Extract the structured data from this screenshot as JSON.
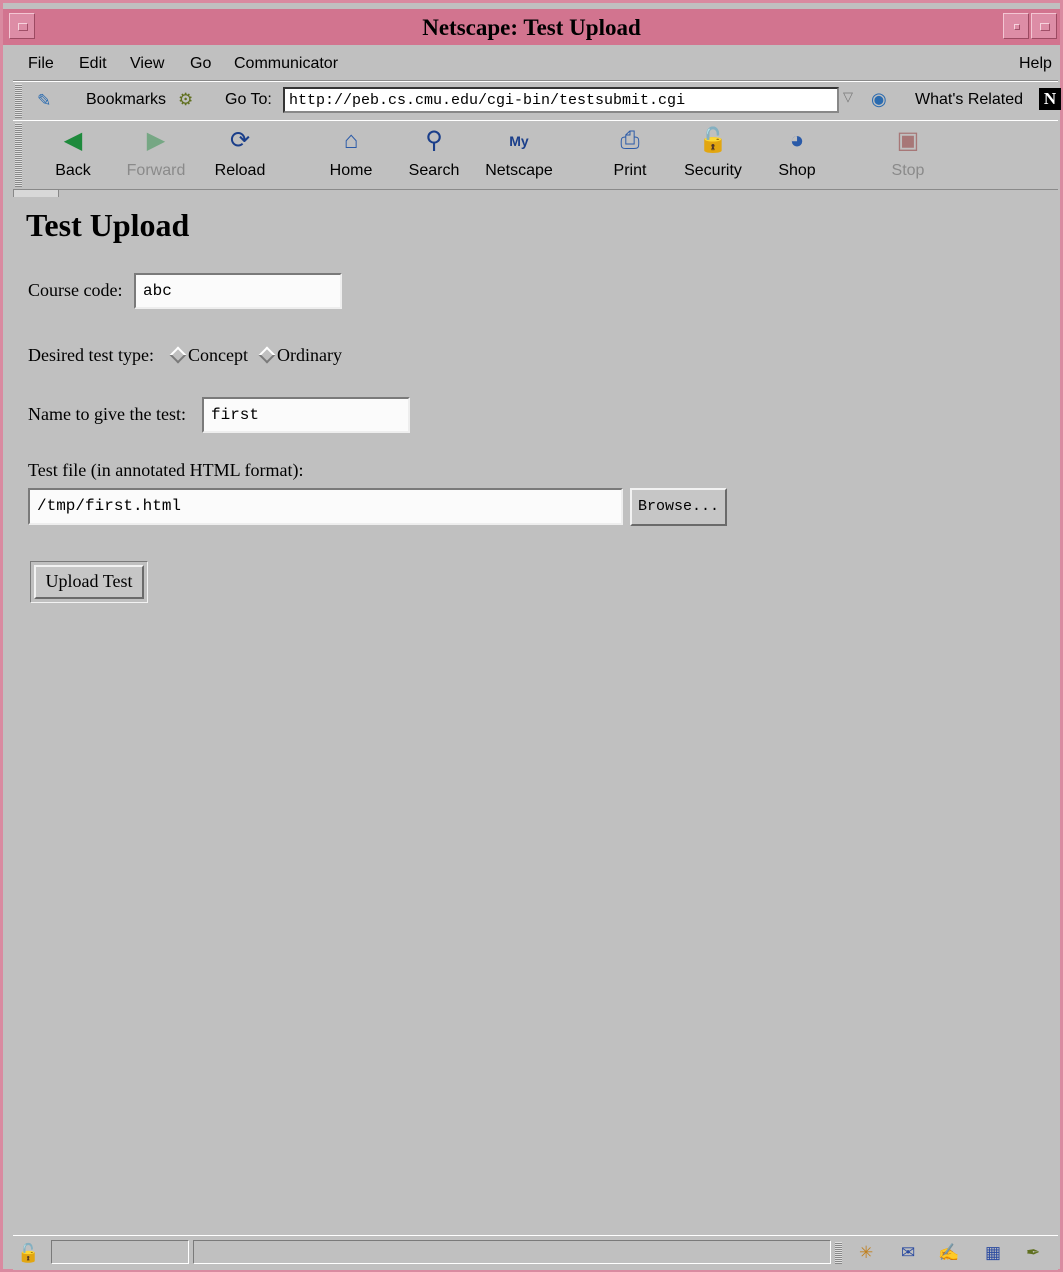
{
  "window": {
    "title": "Netscape: Test Upload"
  },
  "menubar": {
    "items": [
      "File",
      "Edit",
      "View",
      "Go",
      "Communicator"
    ],
    "help": "Help"
  },
  "location_bar": {
    "bookmarks_label": "Bookmarks",
    "goto_label": "Go To:",
    "url": "http://peb.cs.cmu.edu/cgi-bin/testsubmit.cgi",
    "whats_related_label": "What's Related",
    "netscape_logo": "N"
  },
  "toolbar": {
    "buttons": [
      {
        "label": "Back",
        "icon": "back-arrow-icon",
        "enabled": true
      },
      {
        "label": "Forward",
        "icon": "forward-arrow-icon",
        "enabled": false
      },
      {
        "label": "Reload",
        "icon": "reload-icon",
        "enabled": true
      },
      {
        "label": "Home",
        "icon": "home-icon",
        "enabled": true
      },
      {
        "label": "Search",
        "icon": "search-icon",
        "enabled": true
      },
      {
        "label": "Netscape",
        "icon": "my-netscape-icon",
        "enabled": true
      },
      {
        "label": "Print",
        "icon": "printer-icon",
        "enabled": true
      },
      {
        "label": "Security",
        "icon": "padlock-icon",
        "enabled": true
      },
      {
        "label": "Shop",
        "icon": "shopping-bag-icon",
        "enabled": true
      },
      {
        "label": "Stop",
        "icon": "stop-icon",
        "enabled": false
      }
    ]
  },
  "page": {
    "heading": "Test Upload",
    "course_code": {
      "label": "Course code:",
      "value": "abc"
    },
    "test_type": {
      "label": "Desired test type:",
      "options": [
        "Concept",
        "Ordinary"
      ],
      "selected": null
    },
    "test_name": {
      "label": "Name to give the test:",
      "value": "first"
    },
    "test_file": {
      "label": "Test file (in annotated HTML format):",
      "value": "/tmp/first.html",
      "browse_label": "Browse..."
    },
    "submit_label": "Upload Test"
  },
  "colors": {
    "titlebar": "#d2748f",
    "chrome": "#c0c0c0"
  }
}
